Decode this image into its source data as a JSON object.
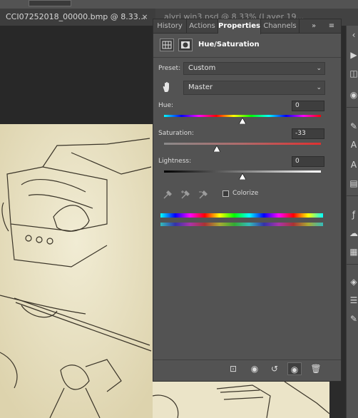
{
  "document_tabs": [
    {
      "label": "CCI07252018_00000.bmp @ 8.33...",
      "close": "×"
    },
    {
      "label": "alyri win3.psd @ 8.33% (Layer 19..."
    }
  ],
  "panel": {
    "tabs": [
      {
        "label": "History"
      },
      {
        "label": "Actions"
      },
      {
        "label": "Properties"
      },
      {
        "label": "Channels"
      }
    ],
    "overflow": "»",
    "active_tab": "Properties",
    "title": "Hue/Saturation",
    "preset_label": "Preset:",
    "preset_value": "Custom",
    "channel_value": "Master",
    "hue_label": "Hue:",
    "hue_value": "0",
    "saturation_label": "Saturation:",
    "saturation_value": "-33",
    "lightness_label": "Lightness:",
    "lightness_value": "0",
    "colorize_label": "Colorize",
    "colorize_checked": false,
    "hue_slider_fraction": 0.5,
    "saturation_slider_fraction": 0.335,
    "lightness_slider_fraction": 0.5
  },
  "icons": {
    "tab_close": "close-icon",
    "panel_menu": "hamburger-menu-icon",
    "hand": "hand-pointer-icon",
    "eyedropper": "eyedropper-icon",
    "eyedropper_add": "eyedropper-plus-icon",
    "eyedropper_sub": "eyedropper-minus-icon",
    "clip": "clip-to-layer-icon",
    "view_prev": "view-previous-state-icon",
    "reset": "reset-icon",
    "visibility": "eye-icon",
    "delete": "trash-icon"
  },
  "colors": {
    "panel_bg": "#535353",
    "tab_bar": "#424242",
    "artwork": "#e9e3c7"
  }
}
